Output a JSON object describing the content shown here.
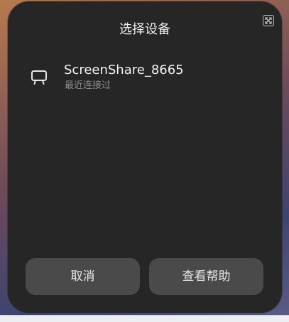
{
  "dialog": {
    "title": "选择设备",
    "expand_icon": "expand-icon"
  },
  "device": {
    "name": "ScreenShare_8665",
    "status": "最近连接过",
    "icon": "tv-icon"
  },
  "buttons": {
    "cancel_label": "取消",
    "help_label": "查看帮助"
  }
}
